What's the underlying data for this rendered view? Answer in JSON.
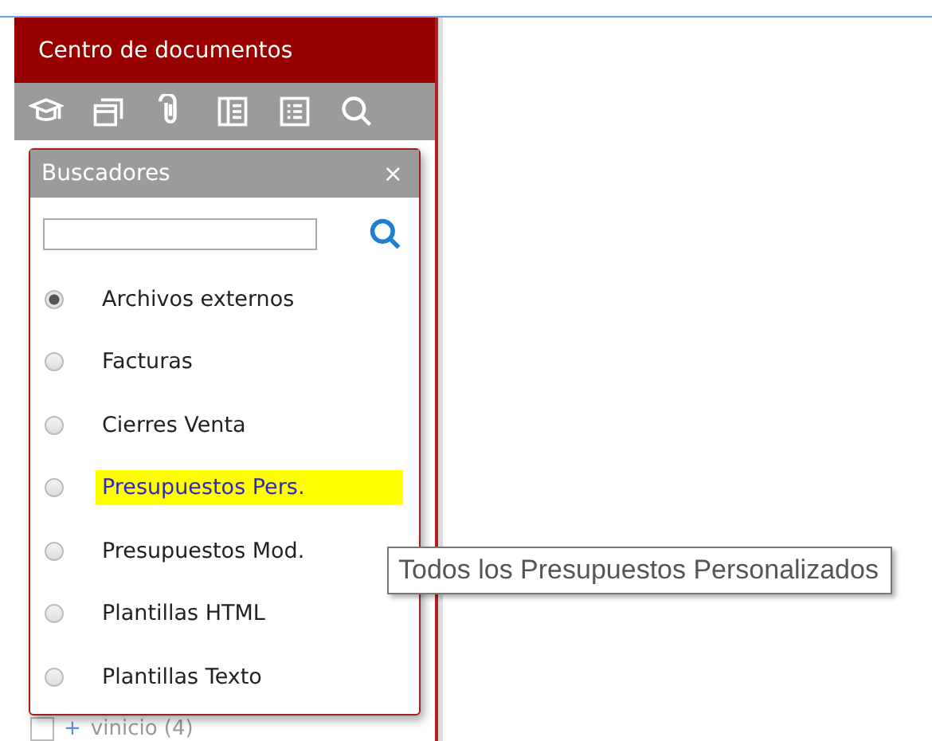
{
  "panel": {
    "title": "Centro de documentos"
  },
  "list_row": {
    "checked": false,
    "expander": "+",
    "label": "vinicio (4)"
  },
  "search_popup": {
    "title": "Buscadores",
    "close": "×",
    "items": [
      {
        "label": "Archivos externos",
        "selected": true,
        "highlighted": false
      },
      {
        "label": "Facturas",
        "selected": false,
        "highlighted": false
      },
      {
        "label": "Cierres Venta",
        "selected": false,
        "highlighted": false
      },
      {
        "label": "Presupuestos Pers.",
        "selected": false,
        "highlighted": true
      },
      {
        "label": "Presupuestos Mod.",
        "selected": false,
        "highlighted": false
      },
      {
        "label": "Plantillas HTML",
        "selected": false,
        "highlighted": false
      },
      {
        "label": "Plantillas Texto",
        "selected": false,
        "highlighted": false
      }
    ]
  },
  "tooltip": {
    "text": "Todos los Presupuestos Personalizados"
  }
}
